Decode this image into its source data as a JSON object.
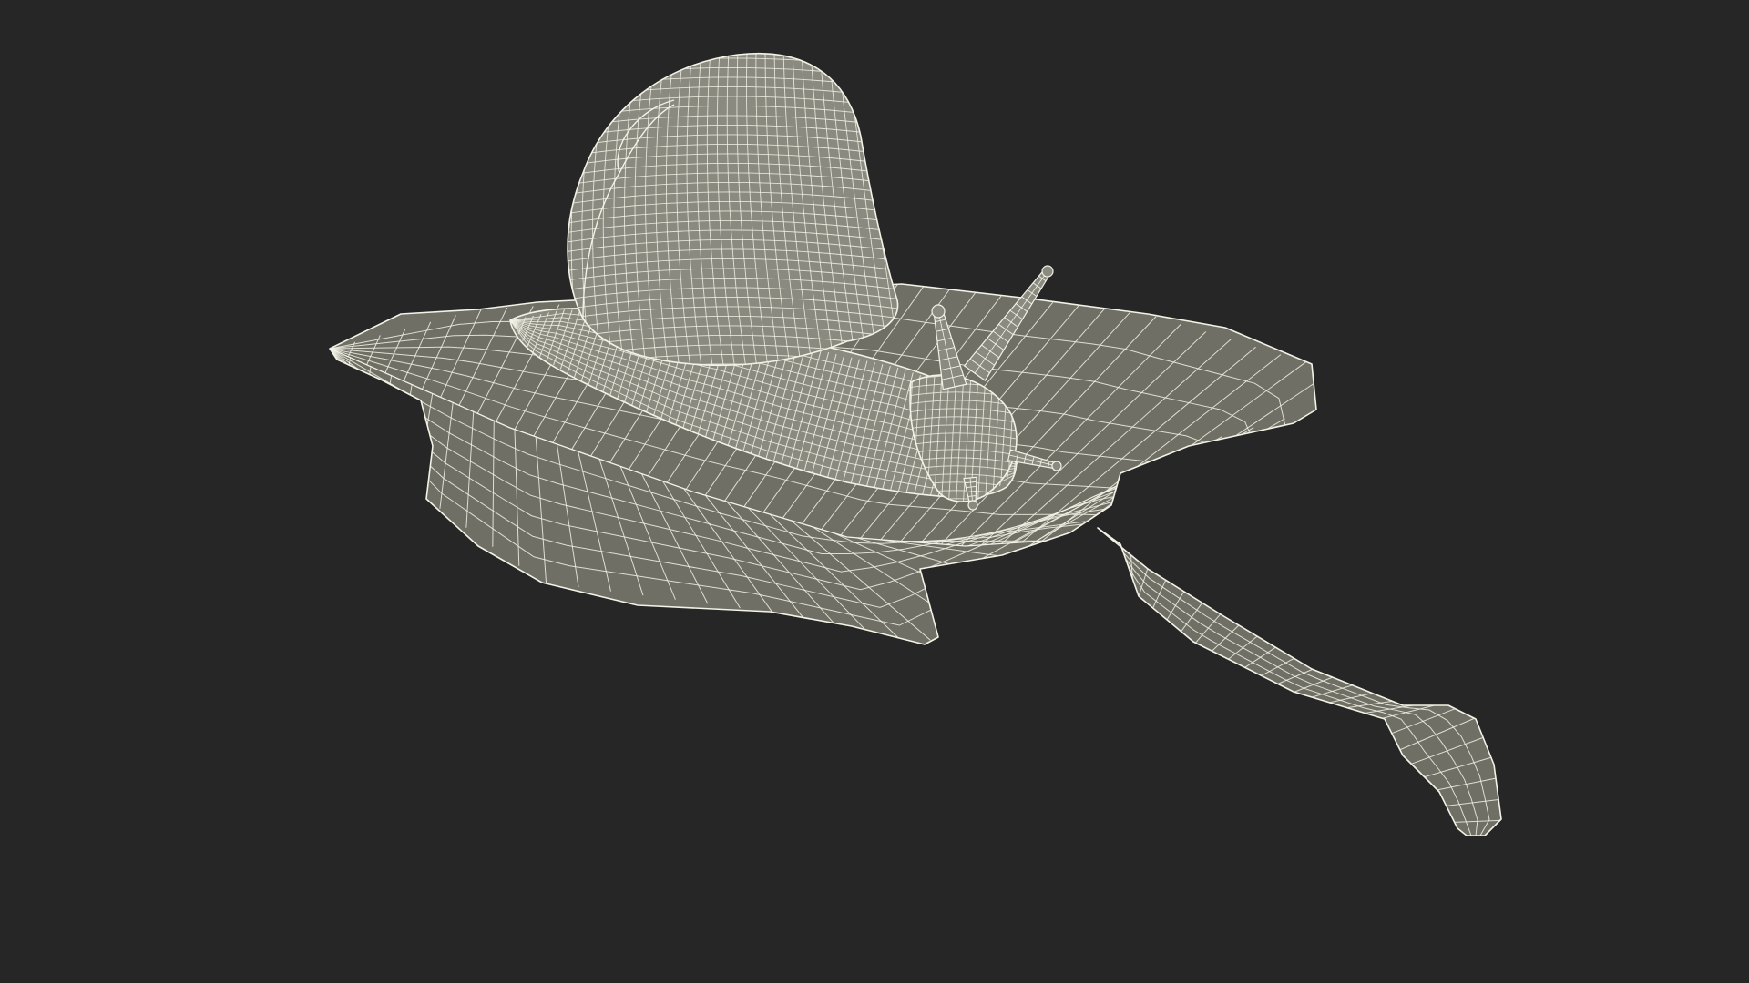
{
  "scene": {
    "subject": "snail-on-leaf-wireframe",
    "background_color": "#262626",
    "surface_color": "#6f6f65",
    "surface_light_color": "#8a8a80",
    "wire_color": "#f2f2e6"
  }
}
